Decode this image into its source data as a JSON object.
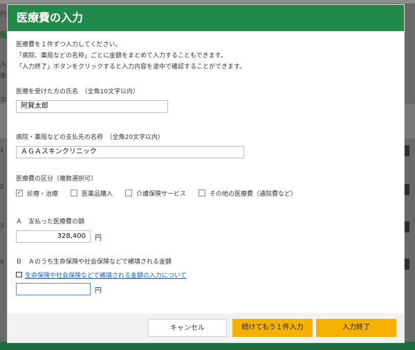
{
  "modal": {
    "title": "医療費の入力",
    "intro": [
      "医療費を１件ずつ入力してください。",
      "「病院、薬局などの名称」ごとに金額をまとめて入力することもできます。",
      "「入力終了」ボタンをクリックすると入力内容を途中で確認することができます。"
    ],
    "patient": {
      "label": "医療を受けた方の氏名　（全角10文字以内）",
      "value": "阿賀太郎"
    },
    "payee": {
      "label": "病院・薬局などの支払先の名称　（全角20文字以内）",
      "value": "ＡＧＡスキンクリニック"
    },
    "category": {
      "label": "医療費の区分（複数選択可）",
      "options": [
        {
          "label": "診療・治療",
          "checked": true
        },
        {
          "label": "医薬品購入",
          "checked": false
        },
        {
          "label": "介護保険サービス",
          "checked": false
        },
        {
          "label": "その他の医療費（通院費など）",
          "checked": false
        }
      ]
    },
    "paid": {
      "label": "Ａ　支払った医療費の額",
      "value": "328,400",
      "unit": "円"
    },
    "reimbursed": {
      "label": "Ｂ　Ａのうち生命保険や社会保険などで補填される金額",
      "link": "生命保険や社会保険などで補填される金額の入力について",
      "value": "",
      "unit": "円"
    },
    "buttons": {
      "cancel": "キャンセル",
      "add_more": "続けてもう１件入力",
      "finish": "入力終了"
    }
  },
  "background": {
    "fragments": [
      "円",
      "医",
      "入",
      "金",
      "カ",
      "1",
      "2",
      "3",
      "4"
    ]
  },
  "colors": {
    "header": "#218a4b",
    "primary_button": "#f5b000",
    "link": "#1a5fb4"
  }
}
